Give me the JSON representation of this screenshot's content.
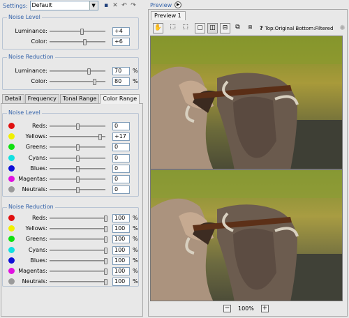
{
  "settings": {
    "label": "Settings:",
    "value": "Default"
  },
  "noise_level_group": {
    "title": "Noise Level",
    "luminance": {
      "label": "Luminance:",
      "value": "+4",
      "level": 0.58
    },
    "color": {
      "label": "Color:",
      "value": "+6",
      "level": 0.62
    }
  },
  "noise_reduction_group": {
    "title": "Noise Reduction",
    "luminance": {
      "label": "Luminance:",
      "value": "70",
      "unit": "%",
      "level": 0.7
    },
    "color": {
      "label": "Color:",
      "value": "80",
      "unit": "%",
      "level": 0.8
    }
  },
  "tabs": [
    "Detail",
    "Frequency",
    "Tonal Range",
    "Color Range"
  ],
  "color_noise_level": {
    "title": "Noise Level",
    "rows": [
      {
        "label": "Reds:",
        "value": "0",
        "color": "#e01010",
        "level": 0.5
      },
      {
        "label": "Yellows:",
        "value": "+17",
        "color": "#f0f000",
        "level": 0.9
      },
      {
        "label": "Greens:",
        "value": "0",
        "color": "#10e010",
        "level": 0.5
      },
      {
        "label": "Cyans:",
        "value": "0",
        "color": "#10e0e0",
        "level": 0.5
      },
      {
        "label": "Blues:",
        "value": "0",
        "color": "#1010d8",
        "level": 0.5
      },
      {
        "label": "Magentas:",
        "value": "0",
        "color": "#e010e0",
        "level": 0.5
      },
      {
        "label": "Neutrals:",
        "value": "0",
        "color": "#9a9a9a",
        "level": 0.5
      }
    ]
  },
  "color_noise_reduction": {
    "title": "Noise Reduction",
    "rows": [
      {
        "label": "Reds:",
        "value": "100",
        "unit": "%",
        "color": "#e01010",
        "level": 1.0
      },
      {
        "label": "Yellows:",
        "value": "100",
        "unit": "%",
        "color": "#f0f000",
        "level": 1.0
      },
      {
        "label": "Greens:",
        "value": "100",
        "unit": "%",
        "color": "#10e010",
        "level": 1.0
      },
      {
        "label": "Cyans:",
        "value": "100",
        "unit": "%",
        "color": "#10e0e0",
        "level": 1.0
      },
      {
        "label": "Blues:",
        "value": "100",
        "unit": "%",
        "color": "#1010d8",
        "level": 1.0
      },
      {
        "label": "Magentas:",
        "value": "100",
        "unit": "%",
        "color": "#e010e0",
        "level": 1.0
      },
      {
        "label": "Neutrals:",
        "value": "100",
        "unit": "%",
        "color": "#9a9a9a",
        "level": 1.0
      }
    ]
  },
  "preview": {
    "label": "Preview",
    "tab": "Preview 1",
    "layout_text": "Top:Original Bottom:Filtered",
    "help": "?",
    "zoom": "100%"
  },
  "icons": [
    "save-icon",
    "delete-icon",
    "undo-icon",
    "redo-icon",
    "hand-icon",
    "selection-icon",
    "crop-selection-icon",
    "single-view-icon",
    "split-vertical-icon",
    "split-horizontal-icon",
    "open-preview-icon",
    "copy-preview-icon",
    "busy-icon",
    "play-icon"
  ]
}
